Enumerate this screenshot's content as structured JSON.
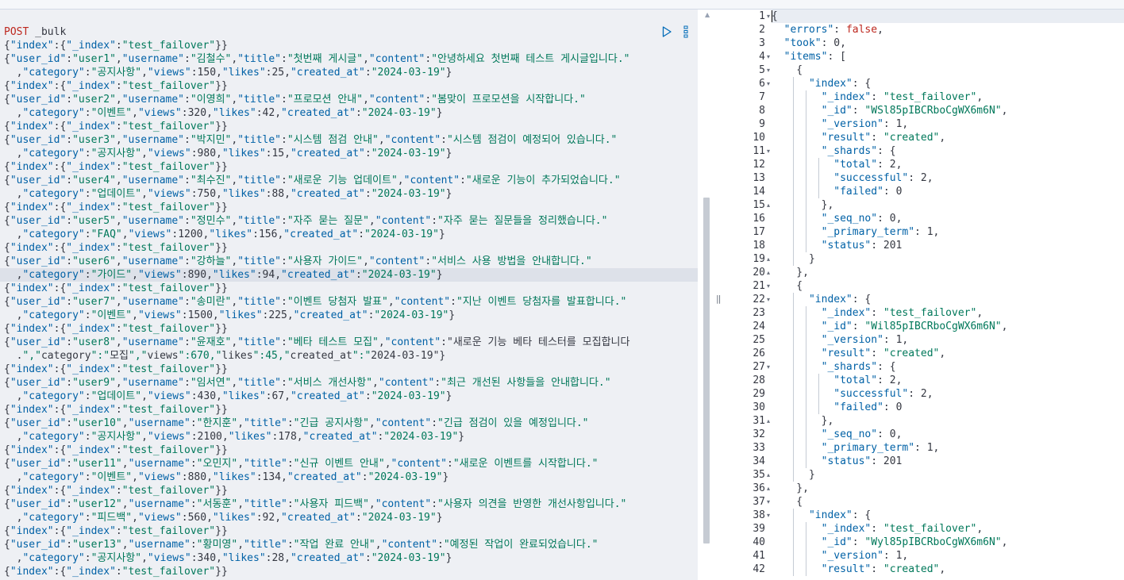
{
  "top_strip": {
    "text": ""
  },
  "request": {
    "method": "POST",
    "path": "_bulk",
    "lines": [
      "{\"index\":{\"_index\":\"test_failover\"}}",
      "{\"user_id\":\"user1\",\"username\":\"김철수\",\"title\":\"첫번째 게시글\",\"content\":\"안녕하세요 첫번째 테스트 게시글입니다.\"",
      "  ,\"category\":\"공지사항\",\"views\":150,\"likes\":25,\"created_at\":\"2024-03-19\"}",
      "{\"index\":{\"_index\":\"test_failover\"}}",
      "{\"user_id\":\"user2\",\"username\":\"이영희\",\"title\":\"프로모션 안내\",\"content\":\"봄맞이 프로모션을 시작합니다.\"",
      "  ,\"category\":\"이벤트\",\"views\":320,\"likes\":42,\"created_at\":\"2024-03-19\"}",
      "{\"index\":{\"_index\":\"test_failover\"}}",
      "{\"user_id\":\"user3\",\"username\":\"박지민\",\"title\":\"시스템 점검 안내\",\"content\":\"시스템 점검이 예정되어 있습니다.\"",
      "  ,\"category\":\"공지사항\",\"views\":980,\"likes\":15,\"created_at\":\"2024-03-19\"}",
      "{\"index\":{\"_index\":\"test_failover\"}}",
      "{\"user_id\":\"user4\",\"username\":\"최수진\",\"title\":\"새로운 기능 업데이트\",\"content\":\"새로운 기능이 추가되었습니다.\"",
      "  ,\"category\":\"업데이트\",\"views\":750,\"likes\":88,\"created_at\":\"2024-03-19\"}",
      "{\"index\":{\"_index\":\"test_failover\"}}",
      "{\"user_id\":\"user5\",\"username\":\"정민수\",\"title\":\"자주 묻는 질문\",\"content\":\"자주 묻는 질문들을 정리했습니다.\"",
      "  ,\"category\":\"FAQ\",\"views\":1200,\"likes\":156,\"created_at\":\"2024-03-19\"}",
      "{\"index\":{\"_index\":\"test_failover\"}}",
      "{\"user_id\":\"user6\",\"username\":\"강하늘\",\"title\":\"사용자 가이드\",\"content\":\"서비스 사용 방법을 안내합니다.\"",
      "  ,\"category\":\"가이드\",\"views\":890,\"likes\":94,\"created_at\":\"2024-03-19\"}",
      "{\"index\":{\"_index\":\"test_failover\"}}",
      "{\"user_id\":\"user7\",\"username\":\"송미란\",\"title\":\"이벤트 당첨자 발표\",\"content\":\"지난 이벤트 당첨자를 발표합니다.\"",
      "  ,\"category\":\"이벤트\",\"views\":1500,\"likes\":225,\"created_at\":\"2024-03-19\"}",
      "{\"index\":{\"_index\":\"test_failover\"}}",
      "{\"user_id\":\"user8\",\"username\":\"윤재호\",\"title\":\"베타 테스트 모집\",\"content\":\"새로운 기능 베타 테스터를 모집합니다",
      "  .\",\"category\":\"모집\",\"views\":670,\"likes\":45,\"created_at\":\"2024-03-19\"}",
      "{\"index\":{\"_index\":\"test_failover\"}}",
      "{\"user_id\":\"user9\",\"username\":\"임서연\",\"title\":\"서비스 개선사항\",\"content\":\"최근 개선된 사항들을 안내합니다.\"",
      "  ,\"category\":\"업데이트\",\"views\":430,\"likes\":67,\"created_at\":\"2024-03-19\"}",
      "{\"index\":{\"_index\":\"test_failover\"}}",
      "{\"user_id\":\"user10\",\"username\":\"한지훈\",\"title\":\"긴급 공지사항\",\"content\":\"긴급 점검이 있을 예정입니다.\"",
      "  ,\"category\":\"공지사항\",\"views\":2100,\"likes\":178,\"created_at\":\"2024-03-19\"}",
      "{\"index\":{\"_index\":\"test_failover\"}}",
      "{\"user_id\":\"user11\",\"username\":\"오민지\",\"title\":\"신규 이벤트 안내\",\"content\":\"새로운 이벤트를 시작합니다.\"",
      "  ,\"category\":\"이벤트\",\"views\":880,\"likes\":134,\"created_at\":\"2024-03-19\"}",
      "{\"index\":{\"_index\":\"test_failover\"}}",
      "{\"user_id\":\"user12\",\"username\":\"서동훈\",\"title\":\"사용자 피드백\",\"content\":\"사용자 의견을 반영한 개선사항입니다.\"",
      "  ,\"category\":\"피드백\",\"views\":560,\"likes\":92,\"created_at\":\"2024-03-19\"}",
      "{\"index\":{\"_index\":\"test_failover\"}}",
      "{\"user_id\":\"user13\",\"username\":\"황미영\",\"title\":\"작업 완료 안내\",\"content\":\"예정된 작업이 완료되었습니다.\"",
      "  ,\"category\":\"공지사항\",\"views\":340,\"likes\":28,\"created_at\":\"2024-03-19\"}",
      "{\"index\":{\"_index\":\"test_failover\"}}"
    ],
    "highlighted_line_index": 17
  },
  "response": {
    "lines": [
      "{",
      "  \"errors\": false,",
      "  \"took\": 0,",
      "  \"items\": [",
      "    {",
      "      \"index\": {",
      "        \"_index\": \"test_failover\",",
      "        \"_id\": \"WSl85pIBCRboCgWX6m6N\",",
      "        \"_version\": 1,",
      "        \"result\": \"created\",",
      "        \"_shards\": {",
      "          \"total\": 2,",
      "          \"successful\": 2,",
      "          \"failed\": 0",
      "        },",
      "        \"_seq_no\": 0,",
      "        \"_primary_term\": 1,",
      "        \"status\": 201",
      "      }",
      "    },",
      "    {",
      "      \"index\": {",
      "        \"_index\": \"test_failover\",",
      "        \"_id\": \"Wil85pIBCRboCgWX6m6N\",",
      "        \"_version\": 1,",
      "        \"result\": \"created\",",
      "        \"_shards\": {",
      "          \"total\": 2,",
      "          \"successful\": 2,",
      "          \"failed\": 0",
      "        },",
      "        \"_seq_no\": 0,",
      "        \"_primary_term\": 1,",
      "        \"status\": 201",
      "      }",
      "    },",
      "    {",
      "      \"index\": {",
      "        \"_index\": \"test_failover\",",
      "        \"_id\": \"Wyl85pIBCRboCgWX6m6N\",",
      "        \"_version\": 1,",
      "        \"result\": \"created\","
    ],
    "line_numbers": [
      "1",
      "2",
      "3",
      "4",
      "5",
      "6",
      "7",
      "8",
      "9",
      "10",
      "11",
      "12",
      "13",
      "14",
      "15",
      "16",
      "17",
      "18",
      "19",
      "20",
      "21",
      "22",
      "23",
      "24",
      "25",
      "26",
      "27",
      "28",
      "29",
      "30",
      "31",
      "32",
      "33",
      "34",
      "35",
      "36",
      "37",
      "38",
      "39",
      "40",
      "41",
      "42"
    ],
    "fold_markers": {
      "1": "▾",
      "4": "▾",
      "5": "▾",
      "6": "▾",
      "11": "▾",
      "15": "▴",
      "19": "▴",
      "20": "▴",
      "21": "▾",
      "22": "▾",
      "27": "▾",
      "31": "▴",
      "35": "▴",
      "36": "▴",
      "37": "▾",
      "38": "▾"
    }
  },
  "icons": {
    "run": "play-icon",
    "menu": "more-vertical-icon",
    "splitter": "drag-handle-icon"
  },
  "colors": {
    "keyword": "#0061a6",
    "string": "#00785a",
    "boolean": "#bd271e",
    "method": "#bd271e",
    "request_bg": "#eef0f4"
  }
}
